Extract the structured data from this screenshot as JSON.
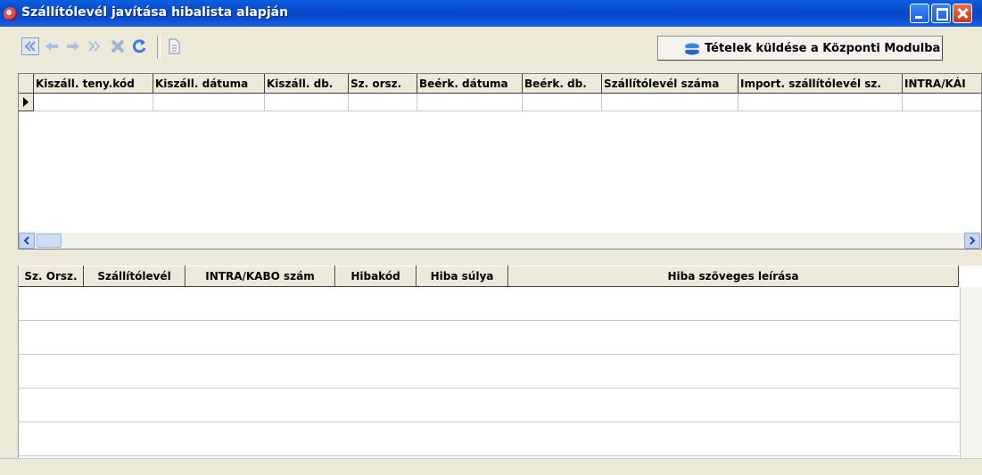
{
  "window": {
    "title": "Szállítólevél javítása hibalista alapján",
    "app_icon": "app-icon"
  },
  "toolbar": {
    "buttons": [
      {
        "name": "first-record-button",
        "icon": "double-arrow-left-icon"
      },
      {
        "name": "previous-record-button",
        "icon": "arrow-left-icon"
      },
      {
        "name": "next-record-button",
        "icon": "arrow-right-icon"
      },
      {
        "name": "last-record-button",
        "icon": "double-arrow-right-icon"
      },
      {
        "name": "delete-button",
        "icon": "x-icon"
      },
      {
        "name": "refresh-button",
        "icon": "refresh-icon"
      },
      {
        "name": "document-button",
        "icon": "document-icon"
      }
    ],
    "send_label": "Tételek küldése a Központi Modulba",
    "send_icon": "send-icon"
  },
  "upper_grid": {
    "columns": [
      "Kiszáll. teny.kód",
      "Kiszáll. dátuma",
      "Kiszáll. db.",
      "Sz. orsz.",
      "Beérk. dátuma",
      "Beérk. db.",
      "Szállítólevél száma",
      "Import. szállítólevél sz.",
      "INTRA/KÁI"
    ],
    "rows": [
      [
        "",
        "",
        "",
        "",
        "",
        "",
        "",
        "",
        ""
      ]
    ]
  },
  "lower_grid": {
    "columns": [
      "Sz. Orsz.",
      "Szállítólevél",
      "INTRA/KABO szám",
      "Hibakód",
      "Hiba súlya",
      "Hiba szöveges leírása"
    ],
    "rows": [
      [
        "",
        "",
        "",
        "",
        "",
        ""
      ],
      [
        "",
        "",
        "",
        "",
        "",
        ""
      ],
      [
        "",
        "",
        "",
        "",
        "",
        ""
      ],
      [
        "",
        "",
        "",
        "",
        "",
        ""
      ],
      [
        "",
        "",
        "",
        "",
        "",
        ""
      ]
    ]
  },
  "colors": {
    "titlebar": "#0a4bd0",
    "window_bg": "#ece9d8",
    "grid_bg": "#ffffff"
  }
}
